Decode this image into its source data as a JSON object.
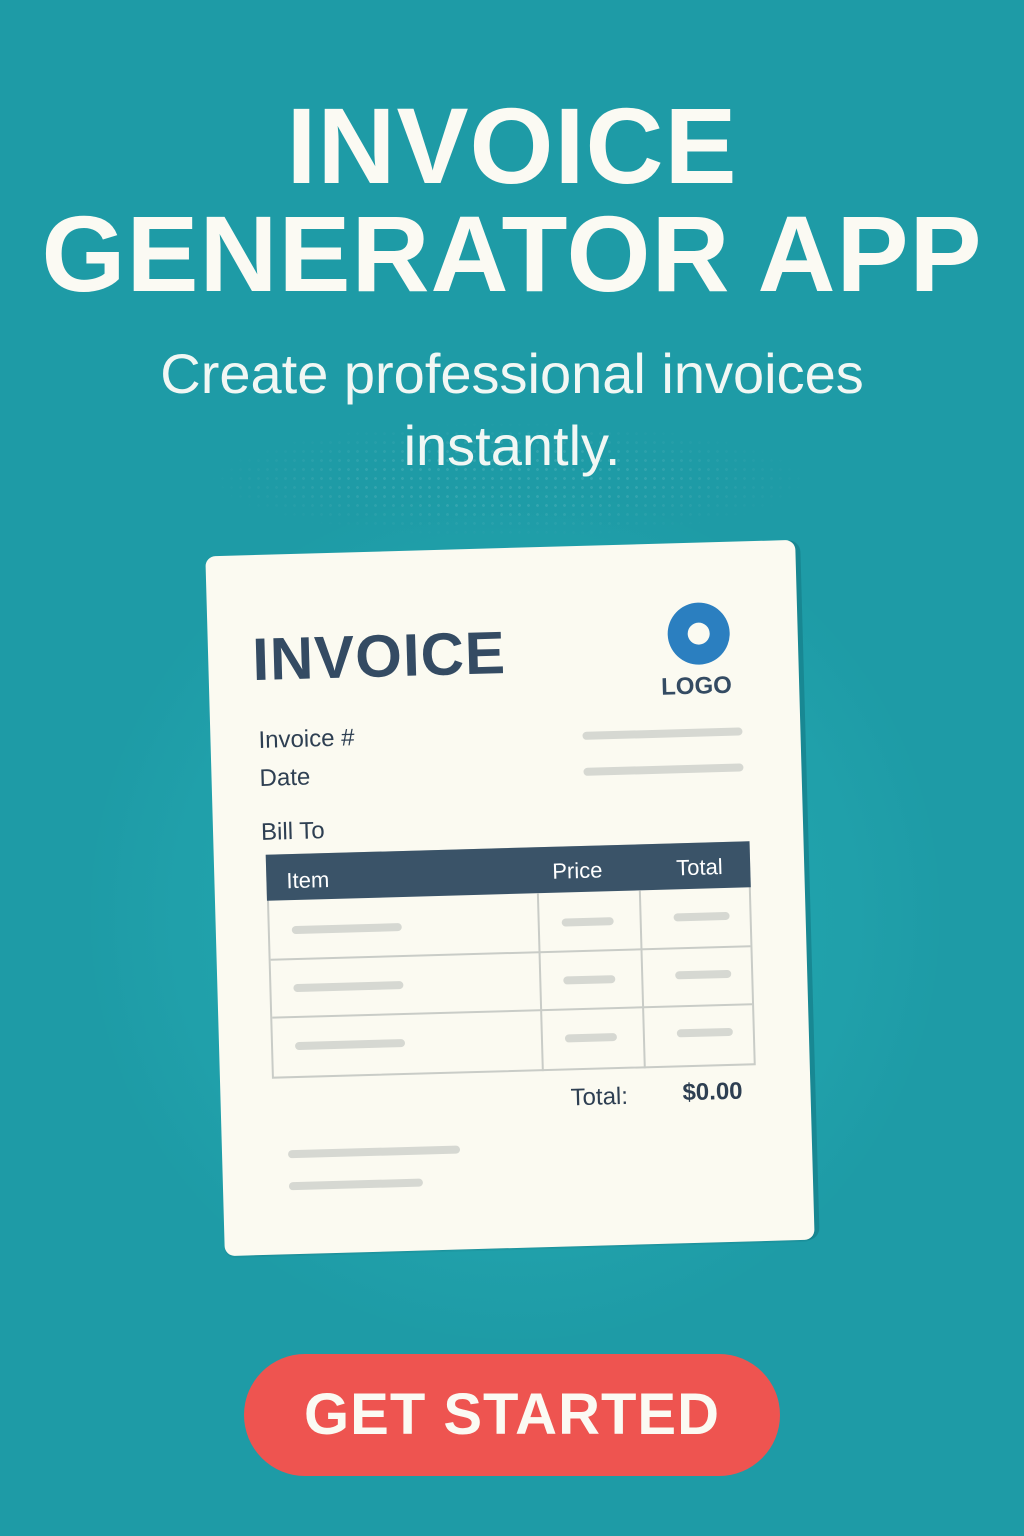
{
  "hero": {
    "title_line1": "INVOICE",
    "title_line2": "GENERATOR APP",
    "subtitle_line1": "Create professional invoices",
    "subtitle_line2": "instantly."
  },
  "invoice_preview": {
    "heading": "INVOICE",
    "logo_label": "LOGO",
    "invoice_number_label": "Invoice #",
    "date_label": "Date",
    "bill_to_label": "Bill To",
    "table_headers": {
      "item": "Item",
      "price": "Price",
      "total": "Total"
    },
    "total_label": "Total:",
    "total_value": "$0.00"
  },
  "cta": {
    "label": "GET STARTED"
  },
  "colors": {
    "background": "#1e9ba6",
    "card": "#fbfaf1",
    "table_header": "#3a5368",
    "logo_accent": "#2b7fc0",
    "cta": "#ee5450",
    "heading_text": "#344b63"
  }
}
